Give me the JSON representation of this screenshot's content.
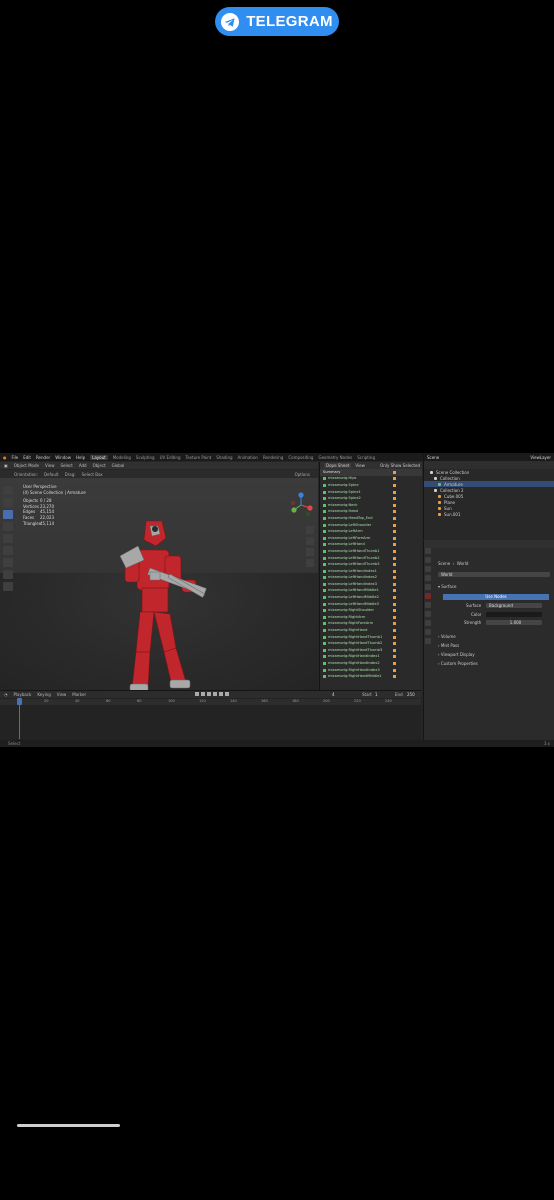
{
  "telegram_button": {
    "label": "TELEGRAM"
  },
  "blender": {
    "menu": [
      "File",
      "Edit",
      "Render",
      "Window",
      "Help"
    ],
    "workspaces": [
      {
        "label": "Layout",
        "active": true
      },
      {
        "label": "Modeling"
      },
      {
        "label": "Sculpting"
      },
      {
        "label": "UV Editing"
      },
      {
        "label": "Texture Paint"
      },
      {
        "label": "Shading"
      },
      {
        "label": "Animation"
      },
      {
        "label": "Rendering"
      },
      {
        "label": "Compositing"
      },
      {
        "label": "Geometry Nodes"
      },
      {
        "label": "Scripting"
      }
    ],
    "scene_label": "Scene",
    "viewlayer_label": "ViewLayer",
    "viewport_header": {
      "mode": "Object Mode",
      "view": "View",
      "select": "Select",
      "add": "Add",
      "object": "Object",
      "transform": "Global"
    },
    "viewport_header2": {
      "orientation": "Orientation:",
      "orientation_value": "Default",
      "drag": "Drag:",
      "drag_value": "Select Box",
      "options": "Options"
    },
    "viewport_overlay": {
      "perspective": "User Perspective",
      "collection": "(4) Scene Collection | Armature",
      "stats": [
        {
          "k": "Objects",
          "v": "0 / 28"
        },
        {
          "k": "Vertices",
          "v": "23,270"
        },
        {
          "k": "Edges",
          "v": "45,154"
        },
        {
          "k": "Faces",
          "v": "22,023"
        },
        {
          "k": "Triangles",
          "v": "45,114"
        }
      ]
    },
    "dopesheet": {
      "header": {
        "mode": "Dope Sheet",
        "view": "View",
        "filter": "Only Show Selected"
      },
      "summary": "Summary",
      "channels": [
        "mixamorig:Hips",
        "mixamorig:Spine",
        "mixamorig:Spine1",
        "mixamorig:Spine2",
        "mixamorig:Neck",
        "mixamorig:Head",
        "mixamorig:HeadTop_End",
        "mixamorig:LeftShoulder",
        "mixamorig:LeftArm",
        "mixamorig:LeftForeArm",
        "mixamorig:LeftHand",
        "mixamorig:LeftHandThumb1",
        "mixamorig:LeftHandThumb2",
        "mixamorig:LeftHandThumb3",
        "mixamorig:LeftHandIndex1",
        "mixamorig:LeftHandIndex2",
        "mixamorig:LeftHandIndex3",
        "mixamorig:LeftHandMiddle1",
        "mixamorig:LeftHandMiddle2",
        "mixamorig:LeftHandMiddle3",
        "mixamorig:RightShoulder",
        "mixamorig:RightArm",
        "mixamorig:RightForeArm",
        "mixamorig:RightHand",
        "mixamorig:RightHandThumb1",
        "mixamorig:RightHandThumb2",
        "mixamorig:RightHandThumb3",
        "mixamorig:RightHandIndex1",
        "mixamorig:RightHandIndex2",
        "mixamorig:RightHandIndex3",
        "mixamorig:RightHandMiddle1"
      ]
    },
    "outliner": {
      "rows": [
        {
          "label": "Scene Collection",
          "selected": false
        },
        {
          "label": "Collection",
          "selected": false
        },
        {
          "label": "Armature",
          "selected": true
        },
        {
          "label": "Collection 2",
          "selected": false
        },
        {
          "label": "Cube.005",
          "selected": false
        },
        {
          "label": "Plane",
          "selected": false
        },
        {
          "label": "Sun",
          "selected": false
        },
        {
          "label": "Sun.001",
          "selected": false
        }
      ]
    },
    "properties": {
      "breadcrumb_scene": "Scene",
      "breadcrumb_world": "World",
      "world_name": "World",
      "surface_panel": "Surface",
      "use_nodes": "Use Nodes",
      "surface_label": "Surface",
      "surface_value": "Background",
      "color_label": "Color",
      "strength_label": "Strength",
      "strength_value": "1.000",
      "panels": [
        "Volume",
        "Mist Pass",
        "Viewport Display",
        "Custom Properties"
      ]
    },
    "timeline": {
      "header": {
        "playback": "Playback",
        "keying": "Keying",
        "view": "View",
        "marker": "Marker"
      },
      "current_frame": "4",
      "start_label": "Start",
      "start": "1",
      "end_label": "End",
      "end": "250",
      "ticks": [
        "20",
        "40",
        "60",
        "80",
        "100",
        "120",
        "140",
        "160",
        "180",
        "200",
        "220",
        "240"
      ]
    },
    "status_bar": {
      "left": "Select",
      "right": "3.x"
    },
    "colors": {
      "accent": "#4772b3",
      "telegram": "#2f8ef0",
      "character": "#c0262b"
    }
  }
}
